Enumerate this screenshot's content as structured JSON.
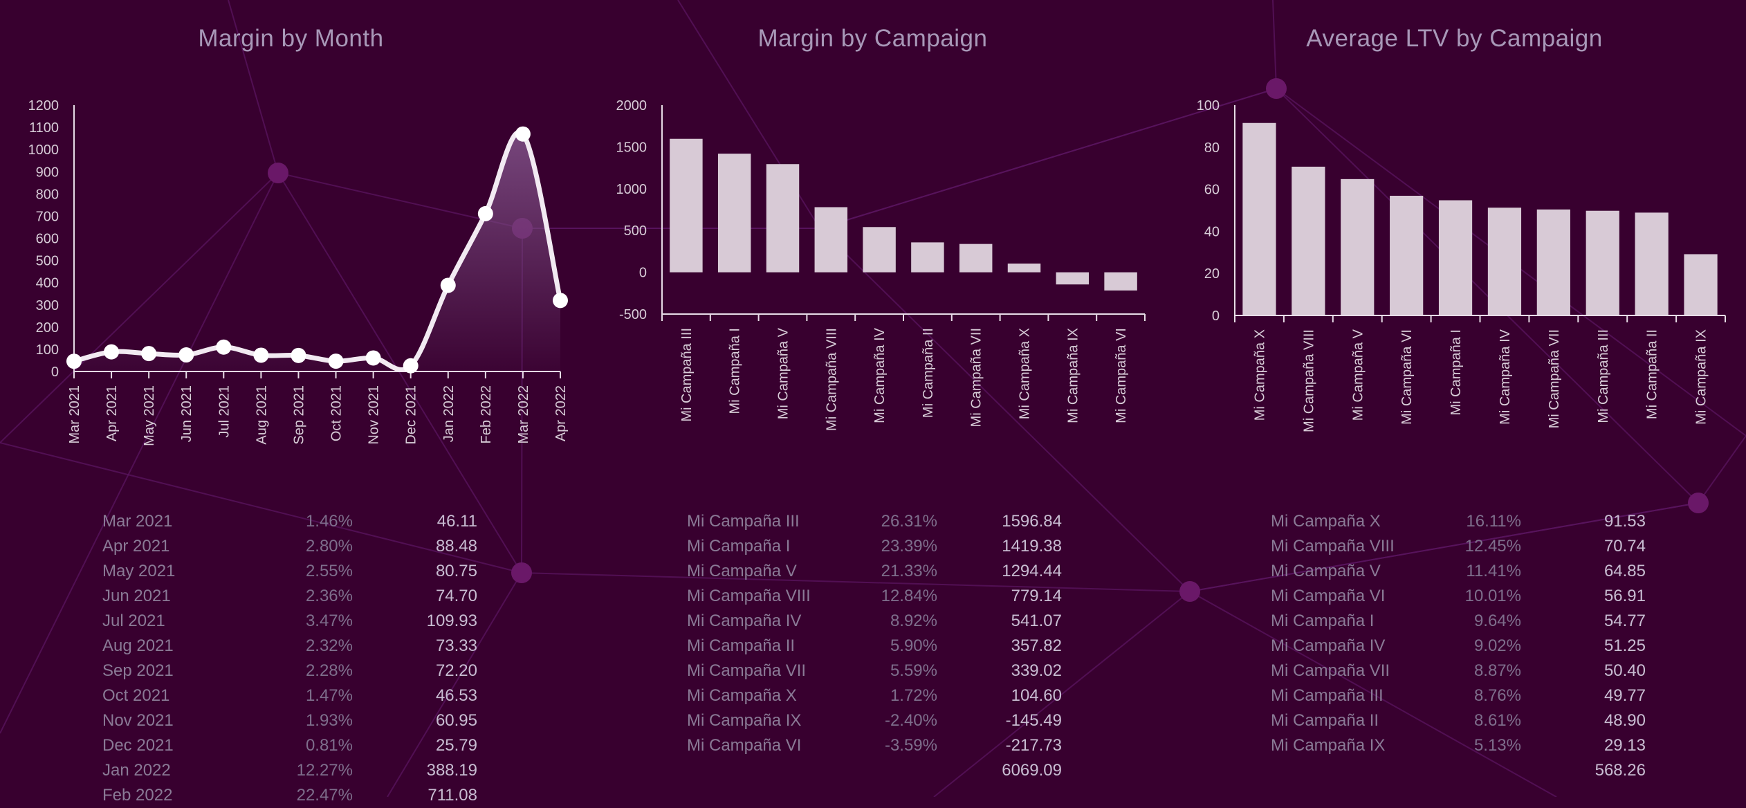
{
  "colors": {
    "background": "#38002f",
    "bar": "#d8cad6",
    "line": "#f2eaf2",
    "area_top": "#7a4a80",
    "network_line": "#5a1560",
    "network_node": "#6a1868"
  },
  "panels": [
    {
      "title": "Margin by Month",
      "table": {
        "rows": [
          {
            "name": "Mar 2021",
            "pct": "1.46%",
            "value": "46.11"
          },
          {
            "name": "Apr 2021",
            "pct": "2.80%",
            "value": "88.48"
          },
          {
            "name": "May 2021",
            "pct": "2.55%",
            "value": "80.75"
          },
          {
            "name": "Jun 2021",
            "pct": "2.36%",
            "value": "74.70"
          },
          {
            "name": "Jul 2021",
            "pct": "3.47%",
            "value": "109.93"
          },
          {
            "name": "Aug 2021",
            "pct": "2.32%",
            "value": "73.33"
          },
          {
            "name": "Sep 2021",
            "pct": "2.28%",
            "value": "72.20"
          },
          {
            "name": "Oct 2021",
            "pct": "1.47%",
            "value": "46.53"
          },
          {
            "name": "Nov 2021",
            "pct": "1.93%",
            "value": "60.95"
          },
          {
            "name": "Dec 2021",
            "pct": "0.81%",
            "value": "25.79"
          },
          {
            "name": "Jan 2022",
            "pct": "12.27%",
            "value": "388.19"
          },
          {
            "name": "Feb 2022",
            "pct": "22.47%",
            "value": "711.08"
          }
        ],
        "total": ""
      }
    },
    {
      "title": "Margin by Campaign",
      "table": {
        "rows": [
          {
            "name": "Mi Campaña III",
            "pct": "26.31%",
            "value": "1596.84"
          },
          {
            "name": "Mi Campaña I",
            "pct": "23.39%",
            "value": "1419.38"
          },
          {
            "name": "Mi Campaña V",
            "pct": "21.33%",
            "value": "1294.44"
          },
          {
            "name": "Mi Campaña VIII",
            "pct": "12.84%",
            "value": "779.14"
          },
          {
            "name": "Mi Campaña IV",
            "pct": "8.92%",
            "value": "541.07"
          },
          {
            "name": "Mi Campaña II",
            "pct": "5.90%",
            "value": "357.82"
          },
          {
            "name": "Mi Campaña VII",
            "pct": "5.59%",
            "value": "339.02"
          },
          {
            "name": "Mi Campaña X",
            "pct": "1.72%",
            "value": "104.60"
          },
          {
            "name": "Mi Campaña IX",
            "pct": "-2.40%",
            "value": "-145.49"
          },
          {
            "name": "Mi Campaña VI",
            "pct": "-3.59%",
            "value": "-217.73"
          }
        ],
        "total": "6069.09"
      }
    },
    {
      "title": "Average LTV by Campaign",
      "table": {
        "rows": [
          {
            "name": "Mi Campaña X",
            "pct": "16.11%",
            "value": "91.53"
          },
          {
            "name": "Mi Campaña VIII",
            "pct": "12.45%",
            "value": "70.74"
          },
          {
            "name": "Mi Campaña V",
            "pct": "11.41%",
            "value": "64.85"
          },
          {
            "name": "Mi Campaña VI",
            "pct": "10.01%",
            "value": "56.91"
          },
          {
            "name": "Mi Campaña I",
            "pct": "9.64%",
            "value": "54.77"
          },
          {
            "name": "Mi Campaña IV",
            "pct": "9.02%",
            "value": "51.25"
          },
          {
            "name": "Mi Campaña VII",
            "pct": "8.87%",
            "value": "50.40"
          },
          {
            "name": "Mi Campaña III",
            "pct": "8.76%",
            "value": "49.77"
          },
          {
            "name": "Mi Campaña II",
            "pct": "8.61%",
            "value": "48.90"
          },
          {
            "name": "Mi Campaña IX",
            "pct": "5.13%",
            "value": "29.13"
          }
        ],
        "total": "568.26"
      }
    }
  ],
  "chart_data": [
    {
      "type": "area",
      "title": "Margin by Month",
      "xlabel": "",
      "ylabel": "",
      "categories": [
        "Mar 2021",
        "Apr 2021",
        "May 2021",
        "Jun 2021",
        "Jul 2021",
        "Aug 2021",
        "Sep 2021",
        "Oct 2021",
        "Nov 2021",
        "Dec 2021",
        "Jan 2022",
        "Feb 2022",
        "Mar 2022",
        "Apr 2022"
      ],
      "values": [
        46.11,
        88.48,
        80.75,
        74.7,
        109.93,
        73.33,
        72.2,
        46.53,
        60.95,
        25.79,
        388.19,
        711.08,
        1070,
        320
      ],
      "ylim": [
        0,
        1200
      ],
      "yticks": [
        0,
        100,
        200,
        300,
        400,
        500,
        600,
        700,
        800,
        900,
        1000,
        1100,
        1200
      ],
      "grid": false,
      "smooth": true,
      "markers": true
    },
    {
      "type": "bar",
      "title": "Margin by Campaign",
      "xlabel": "",
      "ylabel": "",
      "categories": [
        "Mi Campaña III",
        "Mi Campaña I",
        "Mi Campaña V",
        "Mi Campaña VIII",
        "Mi Campaña IV",
        "Mi Campaña II",
        "Mi Campaña VII",
        "Mi Campaña X",
        "Mi Campaña IX",
        "Mi Campaña VI"
      ],
      "values": [
        1596.84,
        1419.38,
        1294.44,
        779.14,
        541.07,
        357.82,
        339.02,
        104.6,
        -145.49,
        -217.73
      ],
      "ylim": [
        -500,
        2000
      ],
      "yticks": [
        -500,
        0,
        500,
        1000,
        1500,
        2000
      ],
      "grid": false
    },
    {
      "type": "bar",
      "title": "Average LTV by Campaign",
      "xlabel": "",
      "ylabel": "",
      "categories": [
        "Mi Campaña X",
        "Mi Campaña VIII",
        "Mi Campaña V",
        "Mi Campaña VI",
        "Mi Campaña I",
        "Mi Campaña IV",
        "Mi Campaña VII",
        "Mi Campaña III",
        "Mi Campaña II",
        "Mi Campaña IX"
      ],
      "values": [
        91.53,
        70.74,
        64.85,
        56.91,
        54.77,
        51.25,
        50.4,
        49.77,
        48.9,
        29.13
      ],
      "ylim": [
        0,
        100
      ],
      "yticks": [
        0,
        20,
        40,
        60,
        80,
        100
      ],
      "grid": false
    }
  ]
}
